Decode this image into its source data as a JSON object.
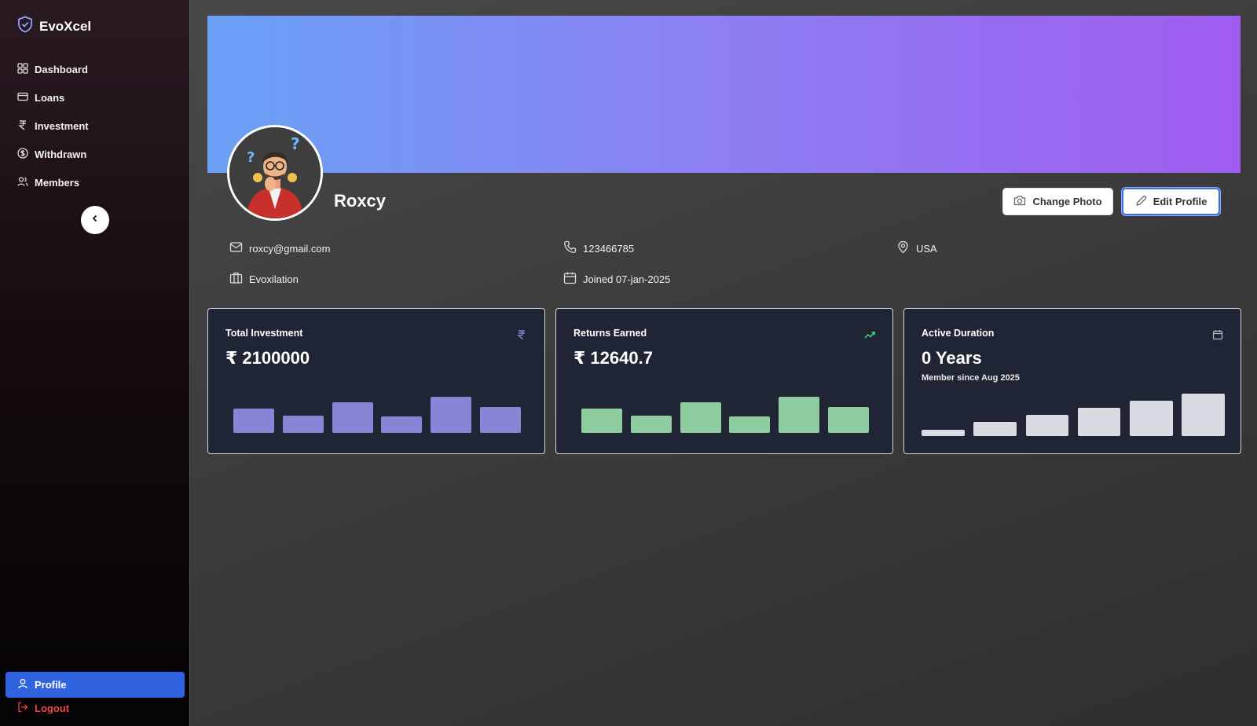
{
  "brand": {
    "name": "EvoXcel",
    "icon": "shield-icon"
  },
  "nav": [
    {
      "label": "Dashboard",
      "icon": "dashboard-icon"
    },
    {
      "label": "Loans",
      "icon": "credit-card-icon"
    },
    {
      "label": "Investment",
      "icon": "rupee-icon"
    },
    {
      "label": "Withdrawn",
      "icon": "dollar-circle-icon"
    },
    {
      "label": "Members",
      "icon": "users-icon"
    }
  ],
  "sidebar_bottom": {
    "profile": "Profile",
    "logout": "Logout"
  },
  "profile": {
    "name": "Roxcy",
    "email": "roxcy@gmail.com",
    "phone": "123466785",
    "location": "USA",
    "company": "Evoxilation",
    "joined": "Joined 07-jan-2025"
  },
  "actions": {
    "change_photo": "Change Photo",
    "edit_profile": "Edit Profile"
  },
  "colors": {
    "banner_start": "#6aa1f5",
    "banner_end": "#a05cef",
    "accent": "#2f63e0",
    "logout": "#ef4444"
  },
  "cards": [
    {
      "title": "Total Investment",
      "value": "₹ 2100000",
      "icon": "rupee-icon",
      "bar_color": "#8a84d6"
    },
    {
      "title": "Returns Earned",
      "value": "₹ 12640.7",
      "icon": "trending-up-icon",
      "bar_color": "#8fcca0"
    },
    {
      "title": "Active Duration",
      "value": "0 Years",
      "subtitle": "Member since Aug 2025",
      "icon": "calendar-icon",
      "bar_color": "#d8dbe2"
    }
  ],
  "chart_data": [
    {
      "type": "bar",
      "series": [
        {
          "values": [
            0.62,
            0.45,
            0.78,
            0.42,
            0.92,
            0.66
          ]
        }
      ],
      "ylim": [
        0,
        1
      ]
    },
    {
      "type": "bar",
      "series": [
        {
          "values": [
            0.62,
            0.45,
            0.78,
            0.42,
            0.92,
            0.66
          ]
        }
      ],
      "ylim": [
        0,
        1
      ]
    },
    {
      "type": "bar",
      "series": [
        {
          "values": [
            0.15,
            0.33,
            0.5,
            0.67,
            0.83,
            1.0
          ]
        }
      ],
      "ylim": [
        0,
        1
      ]
    }
  ]
}
